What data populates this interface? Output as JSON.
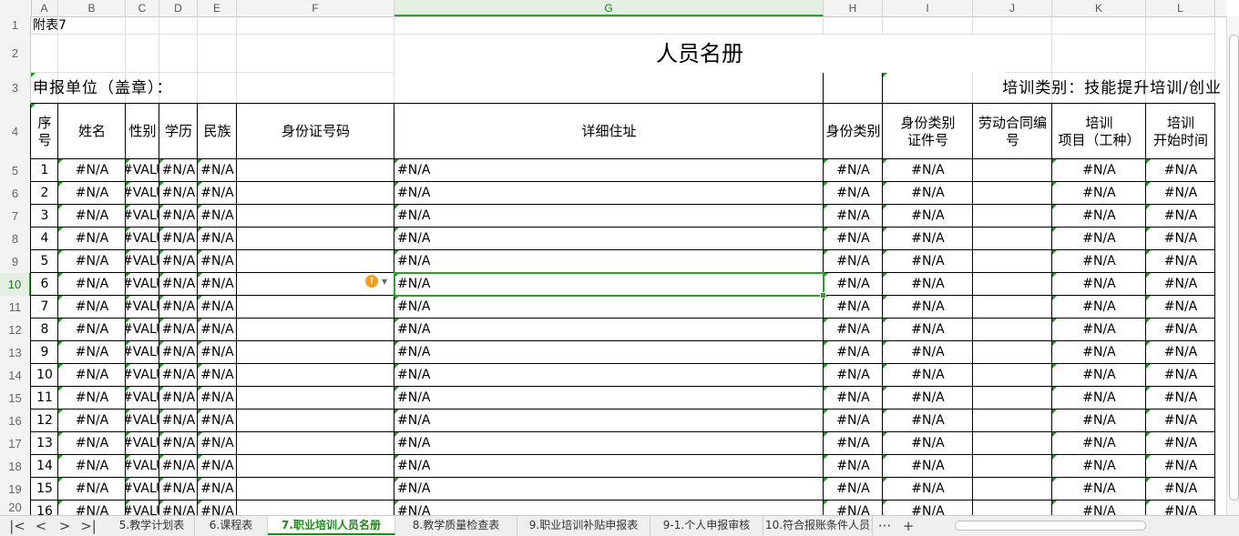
{
  "columns": [
    "A",
    "B",
    "C",
    "D",
    "E",
    "F",
    "G",
    "H",
    "I",
    "J",
    "K",
    "L"
  ],
  "row_numbers": [
    "1",
    "2",
    "3",
    "4",
    "5",
    "6",
    "7",
    "8",
    "9",
    "10",
    "11",
    "12",
    "13",
    "14",
    "15",
    "16",
    "17",
    "18",
    "19",
    "20"
  ],
  "sheet": {
    "attachment_label": "附表7",
    "title": "人员名册",
    "applicant_label": "申报单位（盖章）：",
    "training_type_label": "培训类别：技能提升培训/创业"
  },
  "headers": {
    "seq": "序\n号",
    "name": "姓名",
    "gender": "性别",
    "education": "学历",
    "ethnicity": "民族",
    "id_number": "身份证号码",
    "address": "详细住址",
    "identity_type": "身份类别",
    "identity_cert": "身份类别\n证件号",
    "contract_no": "劳动合同编\n号",
    "training_item": "培训\n项目（工种）",
    "training_start": "培训\n开始时间"
  },
  "rows": [
    {
      "seq": "1",
      "name": "#N/A",
      "gender": "#VALUE!",
      "education": "#N/A",
      "ethnicity": "#N/A",
      "address": "#N/A",
      "identity_type": "#N/A",
      "identity_cert": "#N/A",
      "training_item": "#N/A",
      "training_start": "#N/A"
    },
    {
      "seq": "2",
      "name": "#N/A",
      "gender": "#VALUE!",
      "education": "#N/A",
      "ethnicity": "#N/A",
      "address": "#N/A",
      "identity_type": "#N/A",
      "identity_cert": "#N/A",
      "training_item": "#N/A",
      "training_start": "#N/A"
    },
    {
      "seq": "3",
      "name": "#N/A",
      "gender": "#VALUE!",
      "education": "#N/A",
      "ethnicity": "#N/A",
      "address": "#N/A",
      "identity_type": "#N/A",
      "identity_cert": "#N/A",
      "training_item": "#N/A",
      "training_start": "#N/A"
    },
    {
      "seq": "4",
      "name": "#N/A",
      "gender": "#VALUE!",
      "education": "#N/A",
      "ethnicity": "#N/A",
      "address": "#N/A",
      "identity_type": "#N/A",
      "identity_cert": "#N/A",
      "training_item": "#N/A",
      "training_start": "#N/A"
    },
    {
      "seq": "5",
      "name": "#N/A",
      "gender": "#VALUE!",
      "education": "#N/A",
      "ethnicity": "#N/A",
      "address": "#N/A",
      "identity_type": "#N/A",
      "identity_cert": "#N/A",
      "training_item": "#N/A",
      "training_start": "#N/A"
    },
    {
      "seq": "6",
      "name": "#N/A",
      "gender": "#VALUE!",
      "education": "#N/A",
      "ethnicity": "#N/A",
      "address": "#N/A",
      "identity_type": "#N/A",
      "identity_cert": "#N/A",
      "training_item": "#N/A",
      "training_start": "#N/A"
    },
    {
      "seq": "7",
      "name": "#N/A",
      "gender": "#VALUE!",
      "education": "#N/A",
      "ethnicity": "#N/A",
      "address": "#N/A",
      "identity_type": "#N/A",
      "identity_cert": "#N/A",
      "training_item": "#N/A",
      "training_start": "#N/A"
    },
    {
      "seq": "8",
      "name": "#N/A",
      "gender": "#VALUE!",
      "education": "#N/A",
      "ethnicity": "#N/A",
      "address": "#N/A",
      "identity_type": "#N/A",
      "identity_cert": "#N/A",
      "training_item": "#N/A",
      "training_start": "#N/A"
    },
    {
      "seq": "9",
      "name": "#N/A",
      "gender": "#VALUE!",
      "education": "#N/A",
      "ethnicity": "#N/A",
      "address": "#N/A",
      "identity_type": "#N/A",
      "identity_cert": "#N/A",
      "training_item": "#N/A",
      "training_start": "#N/A"
    },
    {
      "seq": "10",
      "name": "#N/A",
      "gender": "#VALUE!",
      "education": "#N/A",
      "ethnicity": "#N/A",
      "address": "#N/A",
      "identity_type": "#N/A",
      "identity_cert": "#N/A",
      "training_item": "#N/A",
      "training_start": "#N/A"
    },
    {
      "seq": "11",
      "name": "#N/A",
      "gender": "#VALUE!",
      "education": "#N/A",
      "ethnicity": "#N/A",
      "address": "#N/A",
      "identity_type": "#N/A",
      "identity_cert": "#N/A",
      "training_item": "#N/A",
      "training_start": "#N/A"
    },
    {
      "seq": "12",
      "name": "#N/A",
      "gender": "#VALUE!",
      "education": "#N/A",
      "ethnicity": "#N/A",
      "address": "#N/A",
      "identity_type": "#N/A",
      "identity_cert": "#N/A",
      "training_item": "#N/A",
      "training_start": "#N/A"
    },
    {
      "seq": "13",
      "name": "#N/A",
      "gender": "#VALUE!",
      "education": "#N/A",
      "ethnicity": "#N/A",
      "address": "#N/A",
      "identity_type": "#N/A",
      "identity_cert": "#N/A",
      "training_item": "#N/A",
      "training_start": "#N/A"
    },
    {
      "seq": "14",
      "name": "#N/A",
      "gender": "#VALUE!",
      "education": "#N/A",
      "ethnicity": "#N/A",
      "address": "#N/A",
      "identity_type": "#N/A",
      "identity_cert": "#N/A",
      "training_item": "#N/A",
      "training_start": "#N/A"
    },
    {
      "seq": "15",
      "name": "#N/A",
      "gender": "#VALUE!",
      "education": "#N/A",
      "ethnicity": "#N/A",
      "address": "#N/A",
      "identity_type": "#N/A",
      "identity_cert": "#N/A",
      "training_item": "#N/A",
      "training_start": "#N/A"
    },
    {
      "seq": "16",
      "name": "#N/A",
      "gender": "#VALUE!",
      "education": "#N/A",
      "ethnicity": "#N/A",
      "address": "#N/A",
      "identity_type": "#N/A",
      "identity_cert": "#N/A",
      "training_item": "#N/A",
      "training_start": "#N/A"
    }
  ],
  "sheet_tabs": [
    {
      "label": "5.教学计划表",
      "active": false
    },
    {
      "label": "6.课程表",
      "active": false
    },
    {
      "label": "7.职业培训人员名册",
      "active": true
    },
    {
      "label": "8.教学质量检查表",
      "active": false
    },
    {
      "label": "9.职业培训补贴申报表",
      "active": false
    },
    {
      "label": "9-1.个人申报审核",
      "active": false
    },
    {
      "label": "10.符合报账条件人员",
      "active": false
    }
  ],
  "tab_nav": {
    "first": "|<",
    "prev": "<",
    "next": ">",
    "last": ">|",
    "more": "···",
    "add": "+"
  },
  "selected_cell": "G10",
  "colors": {
    "accent": "#2f9e2f",
    "grid": "#000000",
    "header_bg": "#f3f3f3"
  }
}
